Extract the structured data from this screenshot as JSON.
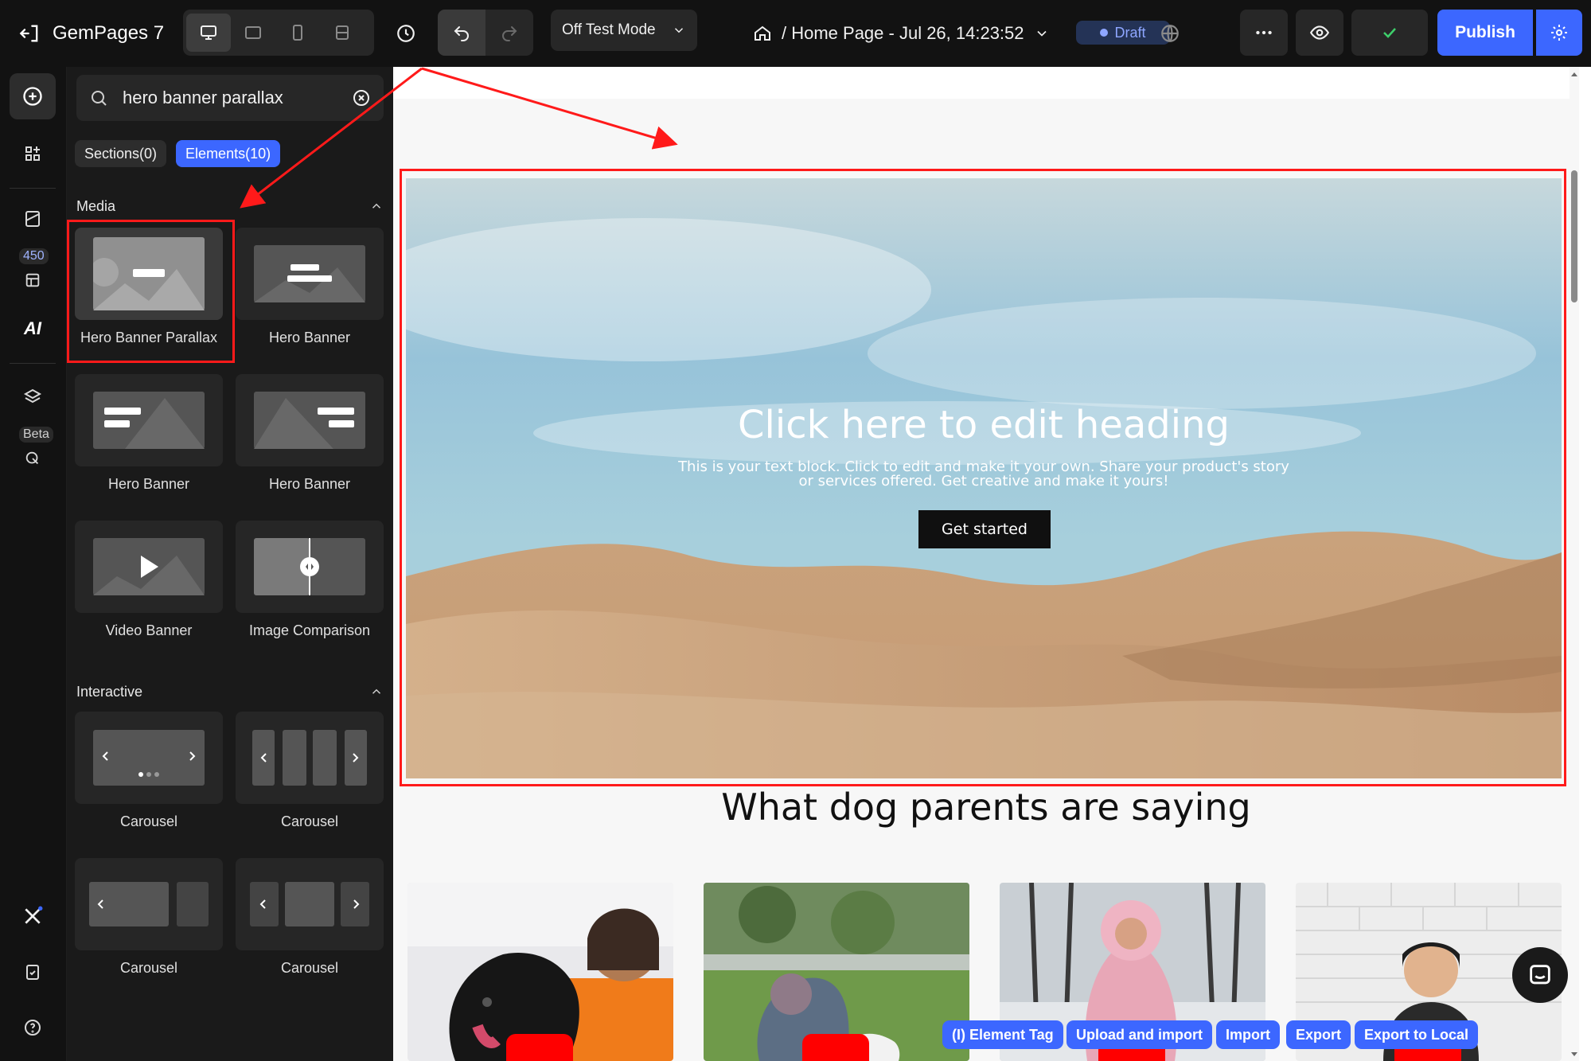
{
  "app": {
    "name": "GemPages 7",
    "test_mode": "Off Test Mode",
    "page_title": "/ Home Page - Jul 26, 14:23:52",
    "status_badge": "Draft",
    "publish_label": "Publish"
  },
  "rail": {
    "badge_count": "450",
    "ai_label": "AI",
    "beta_label": "Beta"
  },
  "panel": {
    "search": {
      "value": "hero banner parallax"
    },
    "tabs": [
      {
        "label": "Sections(0)"
      },
      {
        "label": "Elements(10)"
      }
    ],
    "categories": [
      {
        "label": "Media"
      },
      {
        "label": "Interactive"
      }
    ],
    "media": [
      {
        "label": "Hero Banner Parallax",
        "icon": "hero-banner-parallax-icon"
      },
      {
        "label": "Hero Banner",
        "icon": "hero-banner-center-icon"
      },
      {
        "label": "Hero Banner",
        "icon": "hero-banner-left-icon"
      },
      {
        "label": "Hero Banner",
        "icon": "hero-banner-right-icon"
      },
      {
        "label": "Video Banner",
        "icon": "video-banner-icon"
      },
      {
        "label": "Image Comparison",
        "icon": "image-comparison-icon"
      }
    ],
    "interactive": [
      {
        "label": "Carousel",
        "icon": "carousel-dots-icon"
      },
      {
        "label": "Carousel",
        "icon": "carousel-columns-icon"
      },
      {
        "label": "Carousel",
        "icon": "carousel-peek-left-icon"
      },
      {
        "label": "Carousel",
        "icon": "carousel-peek-both-icon"
      }
    ]
  },
  "canvas": {
    "hero": {
      "heading": "Click here to edit heading",
      "text_line1": "This is your text block. Click to edit and make it your own. Share your product's story",
      "text_line2": "or services offered. Get creative and make it yours!",
      "button": "Get started"
    },
    "section_title": "What dog parents are saying"
  },
  "dev_toolbar": [
    {
      "label": "(I) Element Tag"
    },
    {
      "label": "Upload and import"
    },
    {
      "label": "Import"
    },
    {
      "label": "Export"
    },
    {
      "label": "Export to Local"
    }
  ],
  "colors": {
    "accent": "#3c67ff",
    "highlight": "#ff1a1a",
    "dark_bg": "#121212",
    "panel_bg": "#1a1a1a",
    "draft_text": "#8ea6ff"
  }
}
